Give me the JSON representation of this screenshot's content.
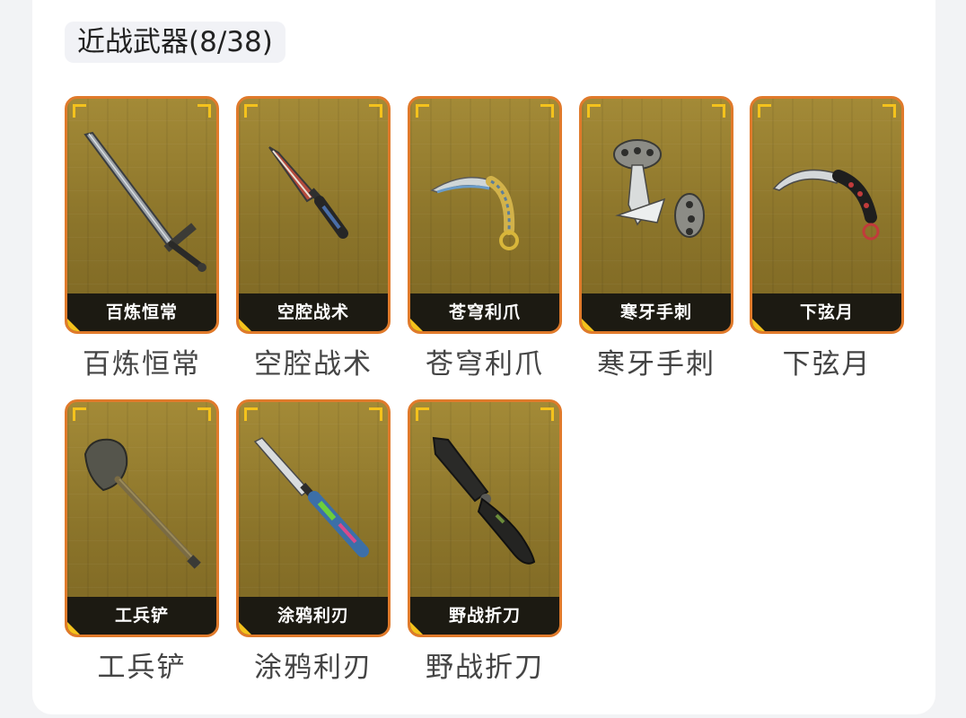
{
  "section": {
    "title": "近战武器(8/38)"
  },
  "items": [
    {
      "name": "百炼恒常",
      "caption": "百炼恒常",
      "icon": "longsword-icon"
    },
    {
      "name": "空腔战术",
      "caption": "空腔战术",
      "icon": "tactical-knife-icon"
    },
    {
      "name": "苍穹利爪",
      "caption": "苍穹利爪",
      "icon": "karambit-icon"
    },
    {
      "name": "寒牙手刺",
      "caption": "寒牙手刺",
      "icon": "push-dagger-icon"
    },
    {
      "name": "下弦月",
      "caption": "下弦月",
      "icon": "karambit-dark-icon"
    },
    {
      "name": "工兵铲",
      "caption": "工兵铲",
      "icon": "shovel-icon"
    },
    {
      "name": "涂鸦利刃",
      "caption": "涂鸦利刃",
      "icon": "graffiti-knife-icon"
    },
    {
      "name": "野战折刀",
      "caption": "野战折刀",
      "icon": "folding-knife-icon"
    }
  ],
  "colors": {
    "card_border": "#e07a2b",
    "card_bg": "#9a8232",
    "corner_accent": "#f4c21c",
    "name_bar": "#1c1a12"
  }
}
